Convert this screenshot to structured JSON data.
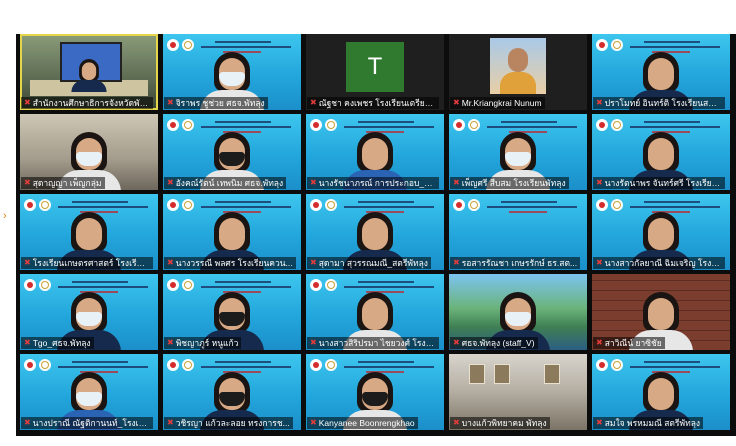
{
  "meeting": {
    "participants": [
      {
        "name": "สำนักงานศึกษาธิการจังหวัดพัทลุง",
        "bg": "office",
        "active": true,
        "kind": "room"
      },
      {
        "name": "จิราพร ชูช่วย ศธจ.พัทลุง",
        "bg": "blue",
        "kind": "person",
        "mask": "white",
        "body": "white"
      },
      {
        "name": "ณัฐชา คงเพชร โรงเรียนเตรียม...",
        "bg": "dark",
        "kind": "avatar",
        "avatar_letter": "T",
        "avatar_color": "#2f7a2f"
      },
      {
        "name": "Mr.Kriangkrai Nunum",
        "bg": "dark",
        "kind": "portrait"
      },
      {
        "name": "ปราโมทย์ อินทร์ติ โรงเรียนสตรีพัทลุง",
        "bg": "blue",
        "kind": "person",
        "mask": "none",
        "body": "navy"
      },
      {
        "name": "สุดาญญา เพ็ญกลุ่ม",
        "bg": "room",
        "kind": "person",
        "mask": "white",
        "body": "white"
      },
      {
        "name": "อังคณ์รัตน์ เทพนิม ศธจ.พัทลุง",
        "bg": "blue",
        "kind": "person",
        "mask": "dark",
        "body": "white"
      },
      {
        "name": "นางรัชนาภรณ์ การประกอบ_สตรีพัทลุง",
        "bg": "blue",
        "kind": "person",
        "mask": "none",
        "body": "blue"
      },
      {
        "name": "เพ็ญศรี สืบสม โรงเรียนพัทลุง",
        "bg": "blue",
        "kind": "person",
        "mask": "white",
        "body": "white"
      },
      {
        "name": "นางรัตนาพร จันทร์ศรี โรงเรียน...",
        "bg": "blue",
        "kind": "person",
        "mask": "none",
        "body": "navy"
      },
      {
        "name": "โรงเรียนเกษตรศาสตร์ โรงเรียนควน...",
        "bg": "blue",
        "kind": "person",
        "mask": "none",
        "body": "navy"
      },
      {
        "name": "นางวรรณี พลศร โรงเรียนควน...",
        "bg": "blue",
        "kind": "person",
        "mask": "none",
        "body": "navy"
      },
      {
        "name": "สุดามา สุวรรณมณี_สตรีพัทลุง",
        "bg": "blue",
        "kind": "person",
        "mask": "none",
        "body": "navy"
      },
      {
        "name": "รอสารรัณชา เกษรรักษ์ ธร.สต...",
        "bg": "blue",
        "kind": "empty"
      },
      {
        "name": "นางสาวกัลยาณี ฉิมเจริญ โรงเรียน...",
        "bg": "blue",
        "kind": "person",
        "mask": "none",
        "body": "navy"
      },
      {
        "name": "Tgo_ศธจ.พัทลุง",
        "bg": "blue",
        "kind": "person",
        "mask": "white",
        "body": "navy"
      },
      {
        "name": "พิชญาภูร์ หนูแก้ว",
        "bg": "blue",
        "kind": "person",
        "mask": "dark",
        "body": "navy"
      },
      {
        "name": "นางสาวสิริปรมา ไชยวงศ์ โรงเรีย...",
        "bg": "blue",
        "kind": "person",
        "mask": "none",
        "body": "white"
      },
      {
        "name": "ศธจ.พัทลุง (staff_V)",
        "bg": "river",
        "kind": "person",
        "mask": "white",
        "body": "navy"
      },
      {
        "name": "สาวิณีน์ ยาซิชัย",
        "bg": "wall",
        "kind": "person",
        "mask": "none",
        "body": "white"
      },
      {
        "name": "นางปราณี ณัฐติกานนท์_โรงเรีย...",
        "bg": "blue",
        "kind": "person",
        "mask": "white",
        "body": "blue"
      },
      {
        "name": "วชิรญา แก้วละลอย ทรงการช...",
        "bg": "blue",
        "kind": "person",
        "mask": "dark",
        "body": "navy"
      },
      {
        "name": "Kanyanee Boonrengkhao",
        "bg": "blue",
        "kind": "person",
        "mask": "dark",
        "body": "white"
      },
      {
        "name": "บางแก้วพิทยาคม พัทลุง",
        "bg": "hall",
        "kind": "hall"
      },
      {
        "name": "สมใจ พรหมมณี สตรีพัทลุง",
        "bg": "blue",
        "kind": "person",
        "mask": "none",
        "body": "navy"
      }
    ]
  },
  "colors": {
    "active_border": "#e4d64c",
    "muted_mic": "#e23b3b",
    "slide_blue": "#23a6dc"
  },
  "icons": {
    "muted": "microphone-muted-icon"
  }
}
